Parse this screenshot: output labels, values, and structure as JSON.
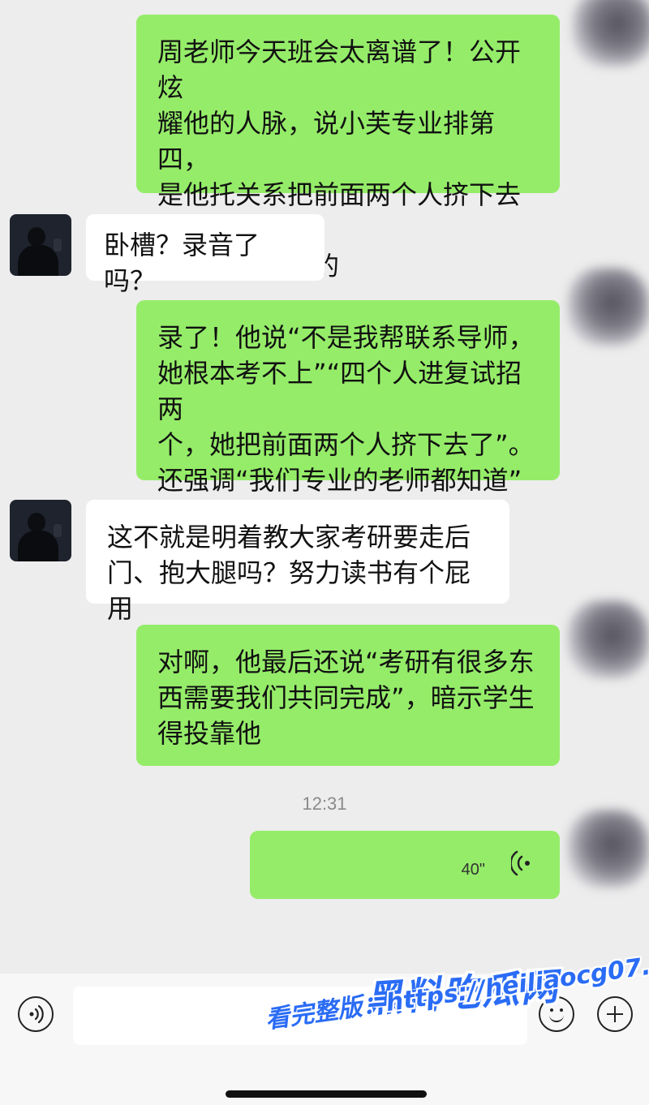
{
  "messages": [
    {
      "side": "me",
      "text": "周老师今天班会太离谱了！公开炫\n耀他的人脉，说小芙专业排第四，\n是他托关系把前面两个人挤下去才\n上云南师大研的"
    },
    {
      "side": "them",
      "text": "卧槽？录音了吗？"
    },
    {
      "side": "me",
      "text": "录了！他说“不是我帮联系导师，\n她根本考不上”“四个人进复试招两\n个，她把前面两个人挤下去了”。\n还强调“我们专业的老师都知道”"
    },
    {
      "side": "them",
      "text": "这不就是明着教大家考研要走后\n门、抱大腿吗？努力读书有个屁用"
    },
    {
      "side": "me",
      "text": "对啊，他最后还说“考研有很多东\n西需要我们共同完成”，暗示学生\n得投靠他"
    }
  ],
  "timestamp": "12:31",
  "voice_message": {
    "duration": "40\""
  },
  "watermark": {
    "logo": "黑料吃瓜网",
    "text": "看完整版：https://heiliaocg07.com"
  },
  "colors": {
    "background": "#ededed",
    "my_bubble": "#95ec69",
    "their_bubble": "#ffffff",
    "watermark": "#2a6cf5"
  },
  "icons": {
    "voice_toggle": "voice-mode-icon",
    "emoji": "emoji-icon",
    "more": "plus-icon",
    "voice_wave": "voice-wave-icon"
  }
}
